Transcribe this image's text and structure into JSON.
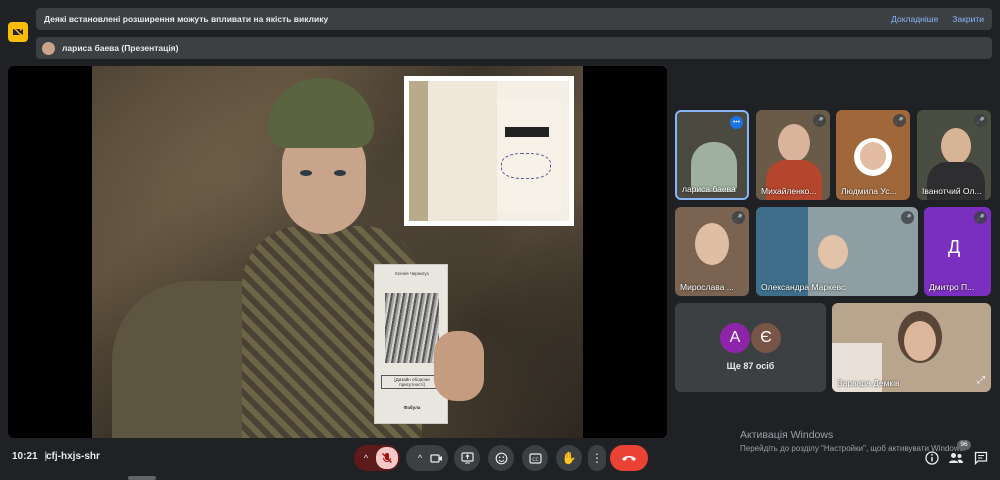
{
  "banner": {
    "message": "Деякі встановлені розширення можуть впливати на якість виклику",
    "details_link": "Докладніше",
    "close_link": "Закрити"
  },
  "presenter": {
    "label": "лариса баева (Презентація)"
  },
  "book": {
    "author": "Ксенія Чернигуз",
    "title": "[Дизайн оборони присутності]",
    "publisher": "Фабула"
  },
  "participants": [
    {
      "name": "лариса баева"
    },
    {
      "name": "Михайленко..."
    },
    {
      "name": "Людмила Ус..."
    },
    {
      "name": "Іванотчий Ол..."
    },
    {
      "name": "Мирослава ..."
    },
    {
      "name": "Олександра Маркевс"
    },
    {
      "name": "Дмитро П..."
    },
    {
      "name": "Варвара Демків"
    }
  ],
  "avatar_letters": {
    "d": "Д",
    "a": "А",
    "ye": "Є"
  },
  "colors": {
    "purple": "#7b2fbf",
    "violet": "#8e24aa",
    "brown": "#795548",
    "end_call": "#ea4335",
    "banner_link": "#8ab4f8"
  },
  "more": {
    "label": "Ще 87 осіб"
  },
  "watermark": {
    "line1": "Активація Windows",
    "line2": "Перейдіть до розділу \"Настройки\", щоб активувати Windows."
  },
  "bottom": {
    "time": "10:21",
    "separator": "|",
    "meeting_code": "cfj-hxjs-shr",
    "people_count": "96"
  }
}
